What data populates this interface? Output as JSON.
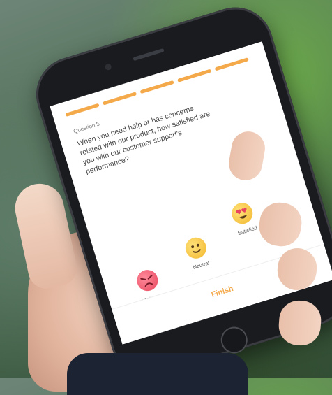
{
  "survey": {
    "progress_segments": 5,
    "question_number": "Question 5",
    "question_text": "When you need help or has concerns related with our product, how satisfied are you with our customer support's performance?",
    "options": [
      {
        "label": "Unhappy",
        "icon": "angry-face-icon"
      },
      {
        "label": "Neutral",
        "icon": "smiling-face-icon"
      },
      {
        "label": "Satisfied",
        "icon": "heart-eyes-face-icon"
      }
    ],
    "finish_label": "Finish"
  },
  "colors": {
    "accent": "#f4a94a",
    "unhappy": "#e8465e",
    "neutral": "#f2b62c"
  }
}
